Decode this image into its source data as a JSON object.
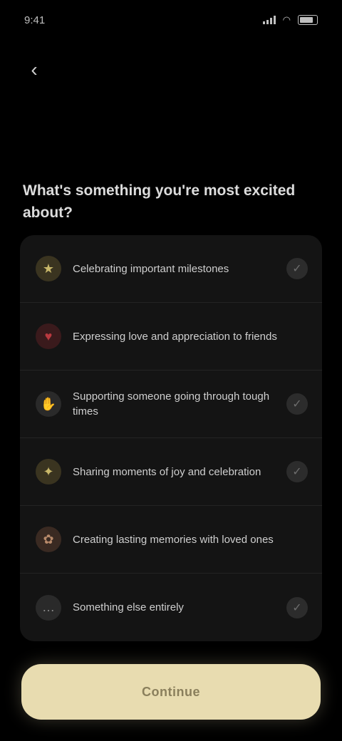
{
  "status_bar": {
    "time": "9:41"
  },
  "header": {
    "back_icon": "arrow-left-icon"
  },
  "question": {
    "text": "What's something you're most excited about?"
  },
  "options": [
    {
      "label": "Celebrating important milestones",
      "icon": "star-icon",
      "icon_color": "#c9b86a",
      "checked": false
    },
    {
      "label": "Expressing love and appreciation to friends",
      "icon": "heart-icon",
      "icon_color": "#b8393f",
      "checked": false
    },
    {
      "label": "Supporting someone going through tough times",
      "icon": "hands-icon",
      "icon_color": "#8a8a8a",
      "checked": false
    },
    {
      "label": "Sharing moments of joy and celebration",
      "icon": "sparkle-icon",
      "icon_color": "#c9b86a",
      "checked": false
    },
    {
      "label": "Creating lasting memories with loved ones",
      "icon": "gift-icon",
      "icon_color": "#b88a6a",
      "checked": false
    },
    {
      "label": "Something else entirely",
      "icon": "dots-icon",
      "icon_color": "#8a8a8a",
      "checked": false
    }
  ],
  "cta": {
    "label": "Continue"
  },
  "colors": {
    "background": "#000000",
    "card": "#141414",
    "accent": "#e8dcb0"
  }
}
